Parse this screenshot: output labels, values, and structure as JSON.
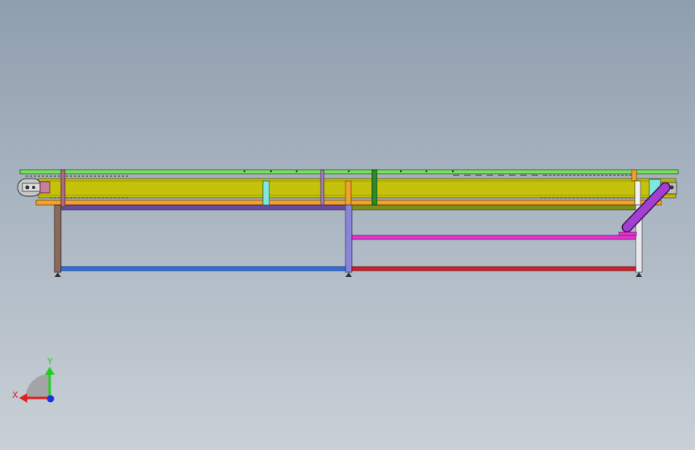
{
  "viewport": {
    "background_top": "#8f9eae",
    "background_bottom": "#c9d0d7"
  },
  "model": {
    "description_colors": {
      "belt_top": "#79e05e",
      "body": "#c6c20c",
      "orange_rail": "#f0a22c",
      "purple_beam": "#6a4aa0",
      "olive_beam": "#7e8f1a",
      "left_leg": "#8a6a5a",
      "middle_leg": "#8a85d8",
      "right_leg": "#e8e8ee",
      "blue_rail": "#2f6fe8",
      "red_rail": "#d1202a",
      "magenta_rail": "#e334d0",
      "diagonal_brace": "#a43ed0",
      "cyan_block": "#7ee8e0",
      "green_post": "#2a8a2a"
    }
  },
  "triad": {
    "x_label": "X",
    "y_label": "Y",
    "x_color": "#e02020",
    "y_color": "#20d020",
    "z_color": "#2030e0"
  }
}
